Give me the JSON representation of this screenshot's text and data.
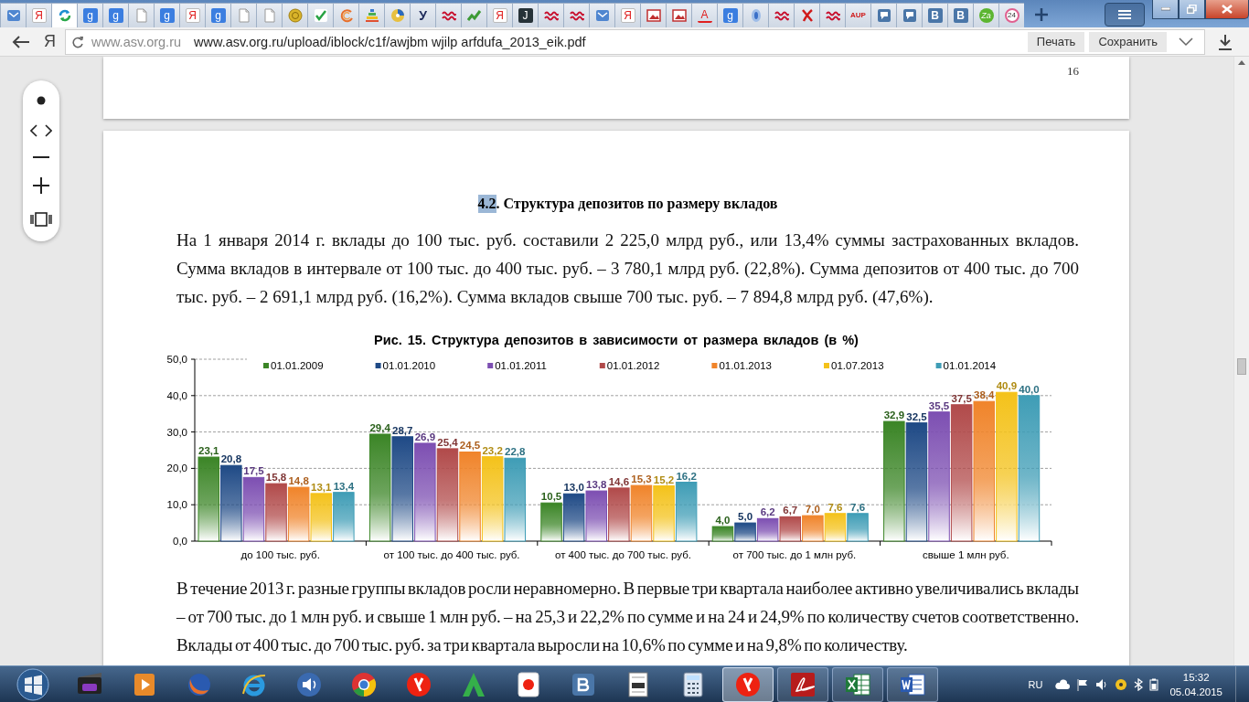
{
  "tabs": [
    {
      "kind": "mail",
      "selected": false
    },
    {
      "kind": "ya",
      "glyph": "Я",
      "selected": false
    },
    {
      "kind": "sync",
      "selected": true
    },
    {
      "kind": "g",
      "glyph": "g",
      "selected": false
    },
    {
      "kind": "g",
      "glyph": "g",
      "selected": false
    },
    {
      "kind": "page",
      "selected": false
    },
    {
      "kind": "g",
      "glyph": "g",
      "selected": false
    },
    {
      "kind": "ya",
      "glyph": "Я",
      "selected": false
    },
    {
      "kind": "g",
      "glyph": "g",
      "selected": false
    },
    {
      "kind": "page",
      "selected": false
    },
    {
      "kind": "page",
      "selected": false
    },
    {
      "kind": "coin",
      "selected": false
    },
    {
      "kind": "check",
      "selected": false
    },
    {
      "kind": "swirl",
      "selected": false
    },
    {
      "kind": "bars",
      "selected": false
    },
    {
      "kind": "disc",
      "selected": false
    },
    {
      "kind": "u",
      "glyph": "У",
      "selected": false
    },
    {
      "kind": "wave",
      "selected": false
    },
    {
      "kind": "trend",
      "selected": false
    },
    {
      "kind": "ya",
      "glyph": "Я",
      "selected": false
    },
    {
      "kind": "j",
      "glyph": "J",
      "selected": false
    },
    {
      "kind": "wave",
      "selected": false
    },
    {
      "kind": "wave",
      "selected": false
    },
    {
      "kind": "mail",
      "selected": false
    },
    {
      "kind": "ya",
      "glyph": "Я",
      "selected": false
    },
    {
      "kind": "image",
      "selected": false
    },
    {
      "kind": "image",
      "selected": false
    },
    {
      "kind": "a",
      "glyph": "A",
      "selected": false
    },
    {
      "kind": "g",
      "glyph": "g",
      "selected": false
    },
    {
      "kind": "drop",
      "selected": false
    },
    {
      "kind": "wave",
      "selected": false
    },
    {
      "kind": "cross",
      "selected": false
    },
    {
      "kind": "wave",
      "selected": false
    },
    {
      "kind": "aup",
      "glyph": "AUP",
      "selected": false
    },
    {
      "kind": "chat",
      "selected": false
    },
    {
      "kind": "chat",
      "selected": false
    },
    {
      "kind": "b",
      "glyph": "B",
      "selected": false
    },
    {
      "kind": "b",
      "glyph": "B",
      "selected": false
    },
    {
      "kind": "za",
      "glyph": "Za",
      "selected": false
    },
    {
      "kind": "n24",
      "glyph": "24",
      "selected": false
    }
  ],
  "address_bar": {
    "logo": "Я",
    "host": "www.asv.org.ru",
    "url": "www.asv.org.ru/upload/iblock/c1f/awjbm wjilp arfdufa_2013_eik.pdf",
    "buttons": [
      "Печать",
      "Сохранить"
    ]
  },
  "viewer": {
    "previous_page": {
      "page_number": "16"
    },
    "page": {
      "heading": {
        "number": "4.2",
        "number_highlighted": true,
        "text": ". Структура депозитов по размеру вкладов"
      },
      "paragraph_1": "На 1 января 2014 г. вклады до 100 тыс. руб. составили 2 225,0 млрд руб., или 13,4% суммы застрахованных вкладов. Сумма вкладов в интервале от 100 тыс. до 400 тыс. руб. – 3 780,1 млрд руб. (22,8%). Сумма депозитов от 400 тыс. до 700 тыс. руб. – 2 691,1 млрд руб. (16,2%). Сумма вкладов свыше 700 тыс. руб. – 7 894,8 млрд руб. (47,6%).",
      "chart_data": {
        "type": "bar",
        "title": "Рис. 15. Структура депозитов в зависимости от размера вкладов (в %)",
        "categories": [
          "до 100 тыс. руб.",
          "от 100 тыс. до 400 тыс. руб.",
          "от 400 тыс. до 700 тыс. руб.",
          "от 700 тыс. до 1 млн руб.",
          "свыше 1 млн руб."
        ],
        "ylim": [
          0,
          50
        ],
        "stacked": false,
        "grid": true,
        "legend": true,
        "data_labels": true,
        "yticks": [
          {
            "value": 0,
            "label": "0,0"
          },
          {
            "value": 10,
            "label": "10,0"
          },
          {
            "value": 20,
            "label": "20,0"
          },
          {
            "value": 30,
            "label": "30,0"
          },
          {
            "value": 40,
            "label": "40,0"
          },
          {
            "value": 50,
            "label": "50,0"
          }
        ],
        "series": [
          {
            "name": "01.01.2009",
            "color": "#3b8526",
            "values": [
              23.1,
              29.4,
              10.5,
              4.0,
              32.9
            ],
            "value_labels": [
              "23,1",
              "29,4",
              "10,5",
              "4,0",
              "32,9"
            ]
          },
          {
            "name": "01.01.2010",
            "color": "#1f4a86",
            "values": [
              20.8,
              28.7,
              13.0,
              5.0,
              32.5
            ],
            "value_labels": [
              "20,8",
              "28,7",
              "13,0",
              "5,0",
              "32,5"
            ]
          },
          {
            "name": "01.01.2011",
            "color": "#7d4fb2",
            "values": [
              17.5,
              26.9,
              13.8,
              6.2,
              35.5
            ],
            "value_labels": [
              "17,5",
              "26,9",
              "13,8",
              "6,2",
              "35,5"
            ]
          },
          {
            "name": "01.01.2012",
            "color": "#b14a4a",
            "values": [
              15.8,
              25.4,
              14.6,
              6.7,
              37.5
            ],
            "value_labels": [
              "15,8",
              "25,4",
              "14,6",
              "6,7",
              "37,5"
            ]
          },
          {
            "name": "01.01.2013",
            "color": "#f0842a",
            "values": [
              14.8,
              24.5,
              15.3,
              7.0,
              38.4
            ],
            "value_labels": [
              "14,8",
              "24,5",
              "15,3",
              "7,0",
              "38,4"
            ]
          },
          {
            "name": "01.07.2013",
            "color": "#f4c21a",
            "values": [
              13.1,
              23.2,
              15.2,
              7.6,
              40.9
            ],
            "value_labels": [
              "13,1",
              "23,2",
              "15,2",
              "7,6",
              "40,9"
            ]
          },
          {
            "name": "01.01.2014",
            "color": "#3f9db6",
            "values": [
              13.4,
              22.8,
              16.2,
              7.6,
              40.0
            ],
            "value_labels": [
              "13,4",
              "22,8",
              "16,2",
              "7,6",
              "40,0"
            ]
          }
        ]
      },
      "paragraph_2": "В течение 2013 г. разные группы вкладов росли неравномерно. В первые три квартала наиболее активно увеличивались вклады – от 700 тыс. до 1 млн руб. и свыше 1 млн руб. – на 25,3 и 22,2% по сумме и на 24 и 24,9% по количеству счетов соответственно. Вклады от 400 тыс. до 700 тыс. руб. за три квартала выросли на 10,6% по сумме и на 9,8% по количеству."
    }
  },
  "taskbar": {
    "apps": [
      {
        "kind": "media",
        "open": false,
        "selected": false
      },
      {
        "kind": "player",
        "open": false,
        "selected": false
      },
      {
        "kind": "firefox",
        "open": false,
        "selected": false
      },
      {
        "kind": "ie",
        "open": false,
        "selected": false
      },
      {
        "kind": "speaker",
        "open": false,
        "selected": false
      },
      {
        "kind": "chrome",
        "open": false,
        "selected": false
      },
      {
        "kind": "yandex",
        "open": false,
        "selected": false
      },
      {
        "kind": "green-a",
        "open": false,
        "selected": false
      },
      {
        "kind": "ya",
        "open": false,
        "selected": false
      },
      {
        "kind": "vk",
        "open": false,
        "selected": false
      },
      {
        "kind": "doc",
        "open": false,
        "selected": false
      },
      {
        "kind": "calc",
        "open": false,
        "selected": false
      },
      {
        "kind": "yandex",
        "open": true,
        "selected": true
      },
      {
        "kind": "pdf",
        "open": true,
        "selected": false
      },
      {
        "kind": "excel",
        "open": true,
        "selected": false
      },
      {
        "kind": "word",
        "open": true,
        "selected": false
      }
    ],
    "language": "RU",
    "time": "15:32",
    "date": "05.04.2015"
  }
}
